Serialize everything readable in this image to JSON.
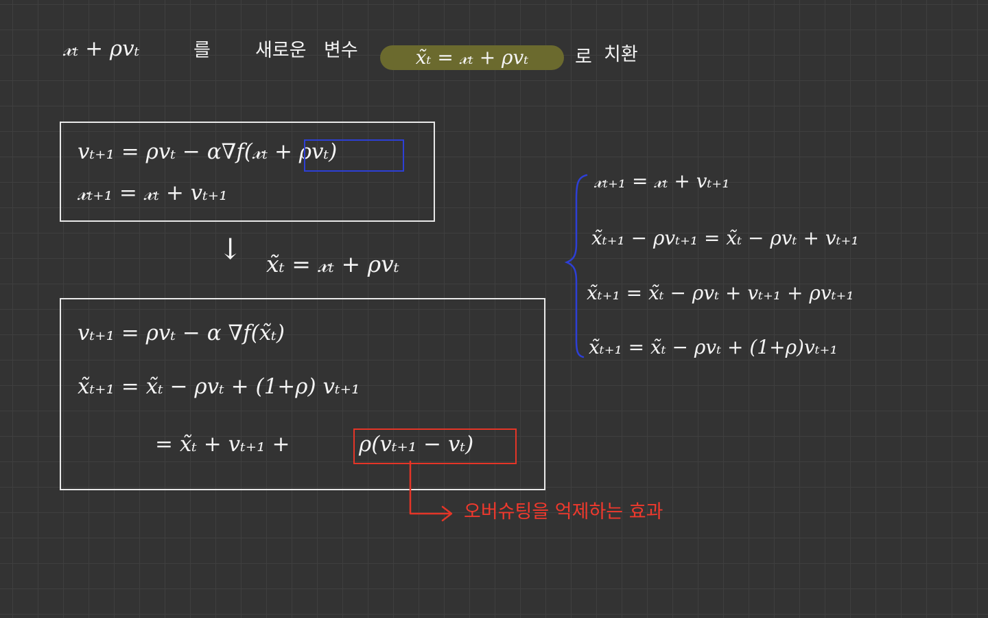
{
  "header": {
    "expr": "𝓍ₜ + ρvₜ",
    "text1": "를",
    "text2": "새로운",
    "text3": "변수",
    "highlight": "x̃ₜ = 𝓍ₜ + ρvₜ",
    "text4": "로",
    "text5": "치환"
  },
  "box1": {
    "line1": "vₜ₊₁ = ρvₜ − α∇f(𝓍ₜ + ρvₜ)",
    "line2": "𝓍ₜ₊₁ = 𝓍ₜ + vₜ₊₁"
  },
  "middle": {
    "arrow": "↓",
    "substitution": "x̃ₜ = 𝓍ₜ + ρvₜ"
  },
  "box2": {
    "line1": "vₜ₊₁ = ρvₜ − α ∇f(x̃ₜ)",
    "line2": "x̃ₜ₊₁ = x̃ₜ − ρvₜ + (1+ρ) vₜ₊₁",
    "line3_left": "= x̃ₜ + vₜ₊₁ +",
    "line3_boxed": "ρ(vₜ₊₁ − vₜ)"
  },
  "derivation": {
    "line1": "𝓍ₜ₊₁ = 𝓍ₜ + vₜ₊₁",
    "line2": "x̃ₜ₊₁ − ρvₜ₊₁ = x̃ₜ − ρvₜ + vₜ₊₁",
    "line3": "x̃ₜ₊₁ = x̃ₜ − ρvₜ + vₜ₊₁ + ρvₜ₊₁",
    "line4": "x̃ₜ₊₁ = x̃ₜ − ρvₜ + (1+ρ)vₜ₊₁"
  },
  "annotation": {
    "text": "오버슈팅을  억제하는  효과"
  },
  "colors": {
    "background": "#333333",
    "ink": "#f4f4f4",
    "highlight": "#6b6a2e",
    "blue": "#2d3fd6",
    "red": "#e53527"
  }
}
